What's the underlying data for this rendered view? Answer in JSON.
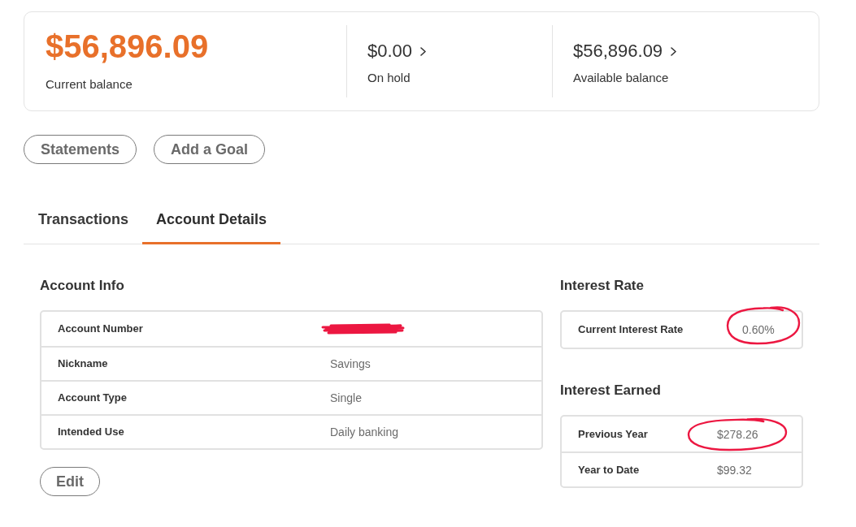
{
  "balance_card": {
    "current": {
      "amount": "$56,896.09",
      "label": "Current balance"
    },
    "figures": [
      {
        "amount": "$0.00",
        "label": "On hold"
      },
      {
        "amount": "$56,896.09",
        "label": "Available balance"
      }
    ]
  },
  "actions": [
    "Statements",
    "Add a Goal"
  ],
  "tabs": [
    {
      "label": "Transactions",
      "selected": false
    },
    {
      "label": "Account Details",
      "selected": true
    }
  ],
  "account_info": {
    "title": "Account Info",
    "rows": [
      {
        "label": "Account Number",
        "redacted": true
      },
      {
        "label": "Nickname",
        "value": "Savings",
        "redacted": false
      },
      {
        "label": "Account Type",
        "value": "Single",
        "redacted": false
      },
      {
        "label": "Intended Use",
        "value": "Daily banking",
        "redacted": false
      }
    ],
    "edit_button": "Edit"
  },
  "interest_rate": {
    "title": "Interest Rate",
    "rows": [
      {
        "label": "Current Interest Rate",
        "value": "0.60%",
        "circled": true
      }
    ]
  },
  "interest_earned": {
    "title": "Interest Earned",
    "rows": [
      {
        "label": "Previous Year",
        "value": "$278.26",
        "circled": true
      },
      {
        "label": "Year to Date",
        "value": "$99.32",
        "circled": false
      }
    ]
  }
}
